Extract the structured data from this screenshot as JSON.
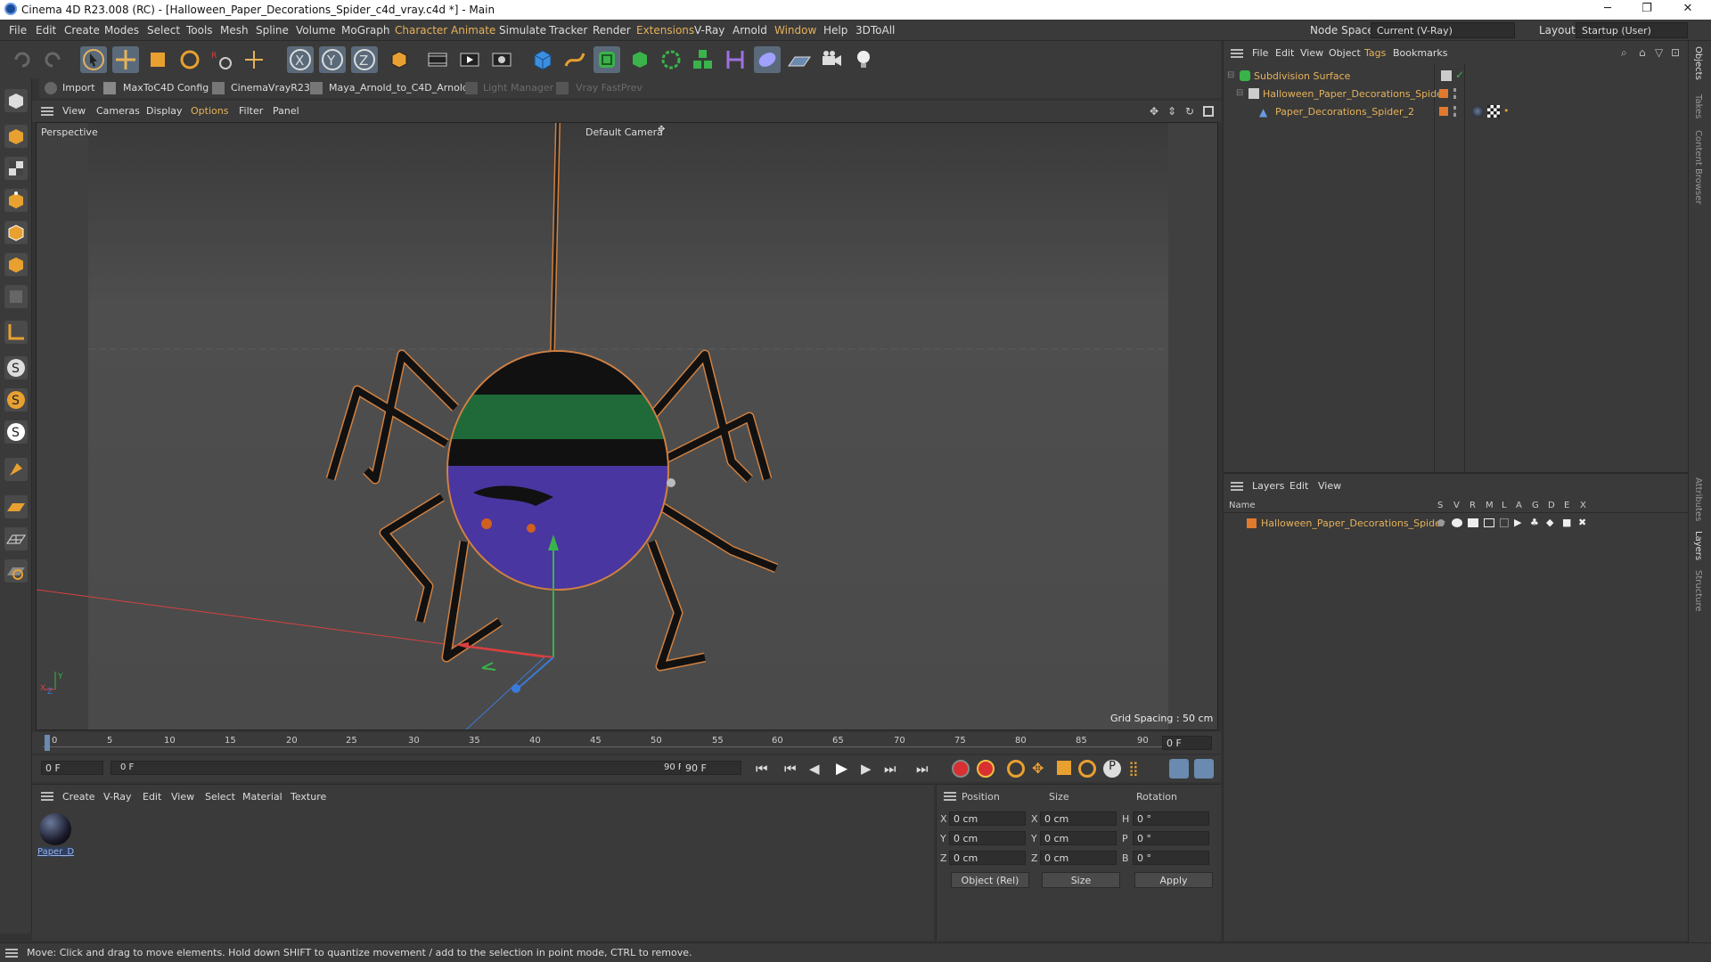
{
  "window": {
    "title": "Cinema 4D R23.008 (RC) - [Halloween_Paper_Decorations_Spider_c4d_vray.c4d *] - Main",
    "minimize": "─",
    "maximize": "❐",
    "close": "✕"
  },
  "menu": {
    "items": [
      "File",
      "Edit",
      "Create",
      "Modes",
      "Select",
      "Tools",
      "Mesh",
      "Spline",
      "Volume",
      "MoGraph",
      "Character",
      "Animate",
      "Simulate",
      "Tracker",
      "Render",
      "Extensions",
      "V-Ray",
      "Arnold",
      "Window",
      "Help",
      "3DToAll"
    ],
    "node_space_label": "Node Space:",
    "node_space_value": "Current (V-Ray)",
    "layout_label": "Layout:",
    "layout_value": "Startup (User)"
  },
  "plugins": {
    "items": [
      "Import",
      "MaxToC4D Config",
      "CinemaVrayR23",
      "Maya_Arnold_to_C4D_Arnold",
      "Light Manager",
      "Vray FastPrev"
    ]
  },
  "viewport_menu": {
    "items": [
      "View",
      "Cameras",
      "Display",
      "Options",
      "Filter",
      "Panel"
    ]
  },
  "viewport": {
    "label": "Perspective",
    "camera": "Default Camera",
    "grid_spacing": "Grid Spacing : 50 cm",
    "axis_y": "Y",
    "axis_x": "X",
    "axis_z": "Z"
  },
  "timeline": {
    "ticks": [
      "0",
      "5",
      "10",
      "15",
      "20",
      "25",
      "30",
      "35",
      "40",
      "45",
      "50",
      "55",
      "60",
      "65",
      "70",
      "75",
      "80",
      "85",
      "90"
    ],
    "current_frame": "0 F"
  },
  "transport": {
    "start_field": "0 F",
    "range_start": "0 F",
    "range_end": "90 F",
    "end_field": "90 F"
  },
  "material_panel": {
    "menu": [
      "Create",
      "V-Ray",
      "Edit",
      "View",
      "Select",
      "Material",
      "Texture"
    ],
    "material_name": "Paper_D"
  },
  "coordinates": {
    "headers": [
      "Position",
      "Size",
      "Rotation"
    ],
    "rows": [
      {
        "axis": "X",
        "pos": "0 cm",
        "size_axis": "X",
        "size": "0 cm",
        "rot_axis": "H",
        "rot": "0 °"
      },
      {
        "axis": "Y",
        "pos": "0 cm",
        "size_axis": "Y",
        "size": "0 cm",
        "rot_axis": "P",
        "rot": "0 °"
      },
      {
        "axis": "Z",
        "pos": "0 cm",
        "size_axis": "Z",
        "size": "0 cm",
        "rot_axis": "B",
        "rot": "0 °"
      }
    ],
    "mode": "Object (Rel)",
    "size_mode": "Size",
    "apply": "Apply"
  },
  "object_manager": {
    "menu": [
      "File",
      "Edit",
      "View",
      "Object",
      "Tags",
      "Bookmarks"
    ],
    "objects": [
      "Subdivision Surface",
      "Halloween_Paper_Decorations_Spider",
      "Paper_Decorations_Spider_2"
    ]
  },
  "layer_manager": {
    "menu": [
      "Layers",
      "Edit",
      "View"
    ],
    "columns": [
      "Name",
      "S",
      "V",
      "R",
      "M",
      "L",
      "A",
      "G",
      "D",
      "E",
      "X"
    ],
    "layers": [
      "Halloween_Paper_Decorations_Spider"
    ]
  },
  "side_tabs": [
    "Objects",
    "Takes",
    "Content Browser",
    "Attributes",
    "Layers",
    "Structure"
  ],
  "status": {
    "text": "Move: Click and drag to move elements. Hold down SHIFT to quantize movement / add to the selection in point mode, CTRL to remove."
  },
  "colors": {
    "accent_orange": "#e6b25a",
    "layer_orange": "#e07a2e",
    "axis_red": "#d84040",
    "axis_green": "#3ab34a",
    "axis_blue": "#3a7ad8"
  }
}
